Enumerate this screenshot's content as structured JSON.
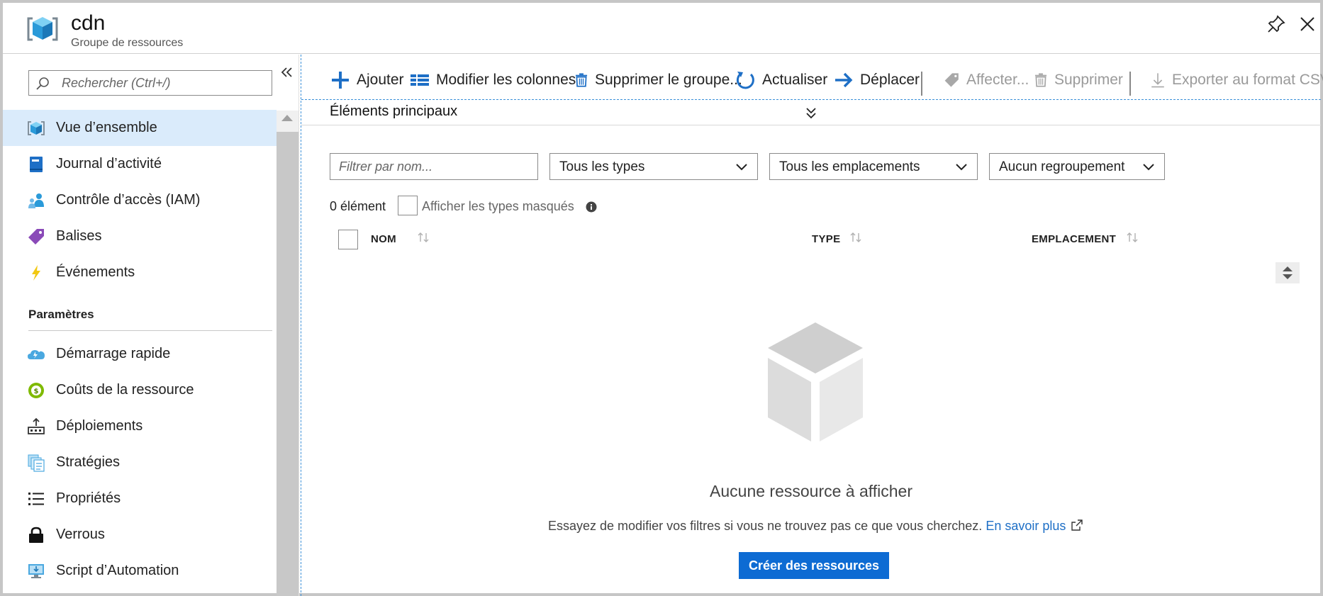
{
  "header": {
    "title": "cdn",
    "subtitle": "Groupe de ressources"
  },
  "sidebar": {
    "search_placeholder": "Rechercher (Ctrl+/)",
    "items": [
      {
        "label": "Vue d’ensemble",
        "icon": "resource-group-icon",
        "active": true
      },
      {
        "label": "Journal d’activité",
        "icon": "activity-log-icon"
      },
      {
        "label": "Contrôle d’accès (IAM)",
        "icon": "access-control-icon"
      },
      {
        "label": "Balises",
        "icon": "tag-icon"
      },
      {
        "label": "Événements",
        "icon": "lightning-icon"
      }
    ],
    "section_title": "Paramètres",
    "settings_items": [
      {
        "label": "Démarrage rapide",
        "icon": "quickstart-cloud-icon"
      },
      {
        "label": "Coûts de la ressource",
        "icon": "cost-icon"
      },
      {
        "label": "Déploiements",
        "icon": "deployment-icon"
      },
      {
        "label": "Stratégies",
        "icon": "policy-icon"
      },
      {
        "label": "Propriétés",
        "icon": "properties-list-icon"
      },
      {
        "label": "Verrous",
        "icon": "lock-icon"
      },
      {
        "label": "Script d’Automation",
        "icon": "automation-script-icon"
      }
    ]
  },
  "toolbar": {
    "add": "Ajouter",
    "edit_columns": "Modifier les colonnes",
    "delete_group": "Supprimer le groupe...",
    "refresh": "Actualiser",
    "move": "Déplacer",
    "assign": "Affecter...",
    "delete": "Supprimer",
    "export_csv": "Exporter au format CSV"
  },
  "essentials": {
    "label": "Éléments principaux"
  },
  "filters": {
    "name_placeholder": "Filtrer par nom...",
    "type": "Tous les types",
    "location": "Tous les emplacements",
    "grouping": "Aucun regroupement"
  },
  "list": {
    "count": "0 élément",
    "show_hidden": "Afficher les types masqués",
    "columns": {
      "name": "NOM",
      "type": "TYPE",
      "location": "EMPLACEMENT"
    }
  },
  "empty": {
    "title": "Aucune ressource à afficher",
    "description": "Essayez de modifier vos filtres si vous ne trouvez pas ce que vous cherchez.",
    "link": "En savoir plus",
    "create_button": "Créer des ressources"
  },
  "colors": {
    "accent": "#0d6bd3",
    "active_nav": "#daebfb",
    "link": "#1e6fc6",
    "disabled_text": "#9a9a9a"
  }
}
